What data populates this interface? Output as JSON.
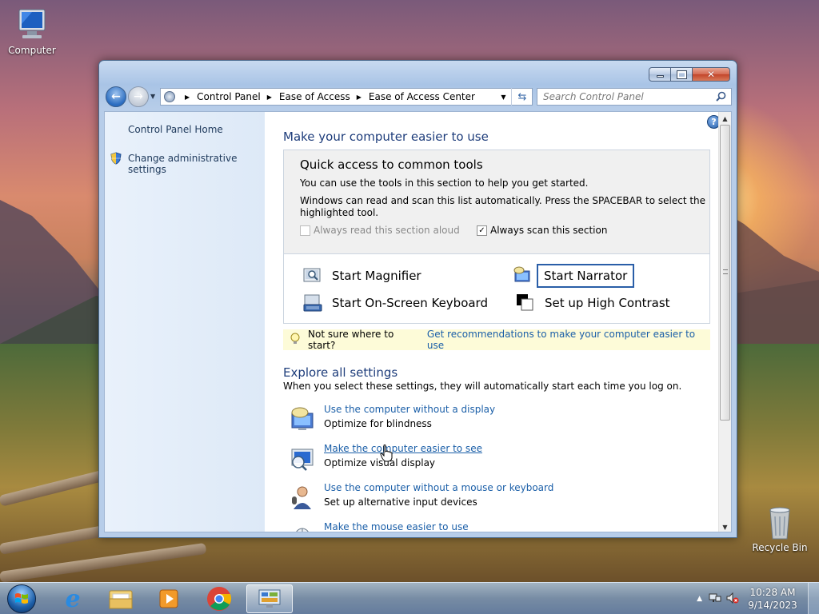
{
  "desktop": {
    "icons": [
      {
        "label": "Computer"
      },
      {
        "label": "Recycle Bin"
      }
    ]
  },
  "window": {
    "controls": {
      "minimize": "minimize-icon",
      "maximize": "maximize-icon",
      "close": "close-icon"
    },
    "breadcrumb": [
      "Control Panel",
      "Ease of Access",
      "Ease of Access Center"
    ],
    "search_placeholder": "Search Control Panel",
    "sidebar": {
      "home_link": "Control Panel Home",
      "admin_link": "Change administrative settings"
    },
    "main": {
      "title": "Make your computer easier to use",
      "quick_access": {
        "heading": "Quick access to common tools",
        "line1": "You can use the tools in this section to help you get started.",
        "line2": "Windows can read and scan this list automatically.  Press the SPACEBAR to select the",
        "line3": "highlighted tool.",
        "read_aloud": {
          "label": "Always read this section aloud",
          "checked": false,
          "enabled": false
        },
        "scan": {
          "label": "Always scan this section",
          "checked": true
        }
      },
      "tools": {
        "magnifier": "Start Magnifier",
        "narrator": "Start Narrator",
        "keyboard": "Start On-Screen Keyboard",
        "contrast": "Set up High Contrast"
      },
      "tip": {
        "prefix": "Not sure where to start?",
        "link": "Get recommendations to make your computer easier to use"
      },
      "explore": {
        "title": "Explore all settings",
        "desc": "When you select these settings, they will automatically start each time you log on.",
        "items": [
          {
            "link": "Use the computer without a display",
            "desc": "Optimize for blindness"
          },
          {
            "link": "Make the computer easier to see",
            "desc": "Optimize visual display"
          },
          {
            "link": "Use the computer without a mouse or keyboard",
            "desc": "Set up alternative input devices"
          },
          {
            "link": "Make the mouse easier to use",
            "desc": ""
          }
        ]
      }
    }
  },
  "taskbar": {
    "clock_time": "10:28 AM",
    "clock_date": "9/14/2023"
  }
}
